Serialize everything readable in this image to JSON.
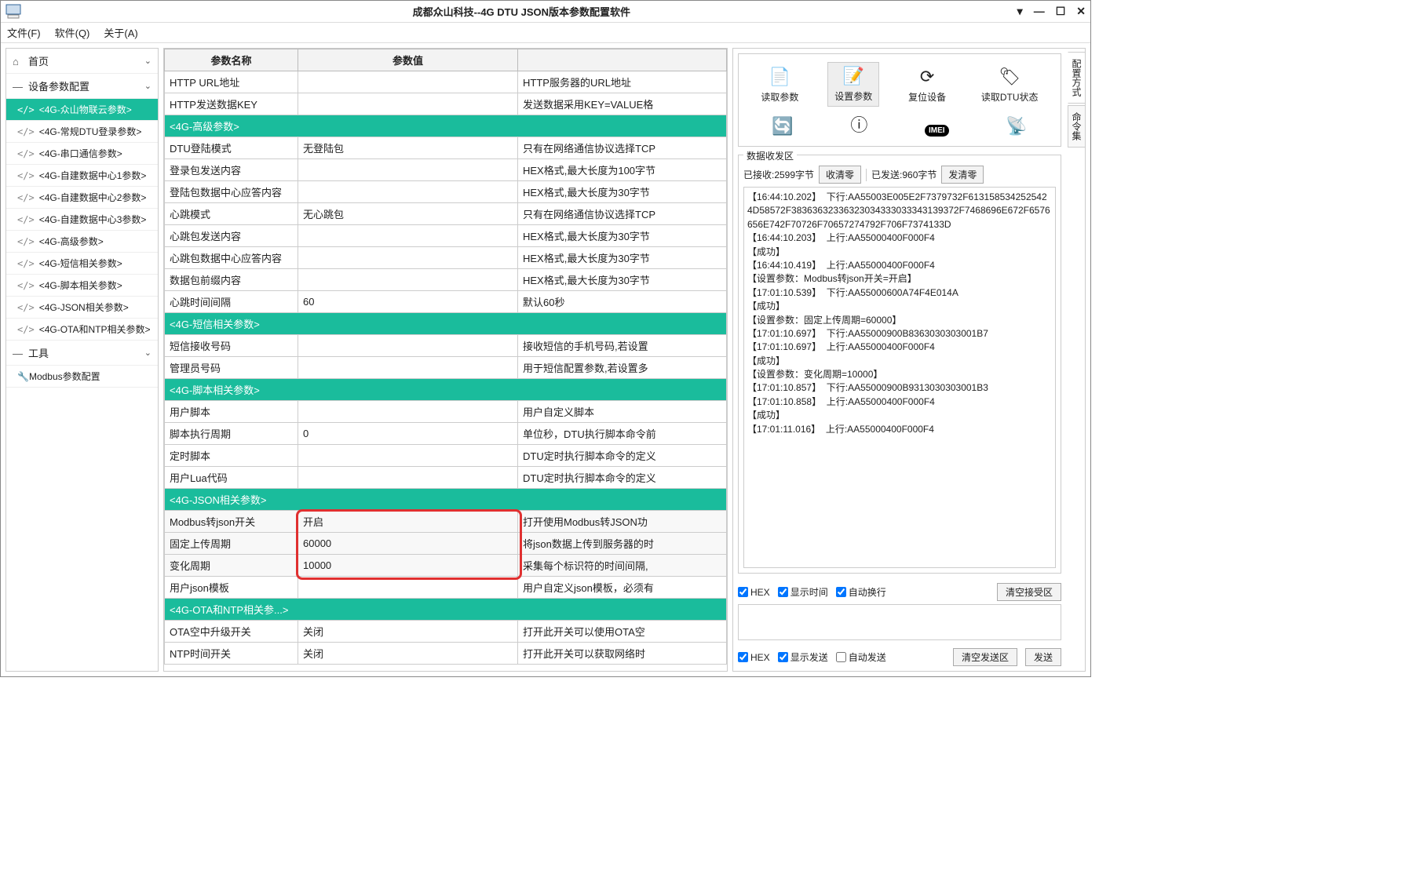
{
  "window": {
    "title": "成都众山科技--4G DTU JSON版本参数配置软件"
  },
  "menu": {
    "file": "文件(F)",
    "software": "软件(Q)",
    "about": "关于(A)"
  },
  "sidebar": {
    "home": "首页",
    "device_params": "设备参数配置",
    "tools": "工具",
    "modbus": "Modbus参数配置",
    "items": [
      "<4G-众山物联云参数>",
      "<4G-常规DTU登录参数>",
      "<4G-串口通信参数>",
      "<4G-自建数据中心1参数>",
      "<4G-自建数据中心2参数>",
      "<4G-自建数据中心3参数>",
      "<4G-高级参数>",
      "<4G-短信相关参数>",
      "<4G-脚本相关参数>",
      "<4G-JSON相关参数>",
      "<4G-OTA和NTP相关参数>"
    ]
  },
  "table": {
    "headers": {
      "name": "参数名称",
      "value": "参数值",
      "desc": ""
    },
    "rows": [
      {
        "name": "HTTP URL地址",
        "value": "",
        "desc": "HTTP服务器的URL地址"
      },
      {
        "name": "HTTP发送数据KEY",
        "value": "",
        "desc": "发送数据采用KEY=VALUE格"
      },
      {
        "section": "<4G-高级参数>"
      },
      {
        "name": "DTU登陆模式",
        "value": "无登陆包",
        "desc": "只有在网络通信协议选择TCP"
      },
      {
        "name": "登录包发送内容",
        "value": "",
        "desc": "HEX格式,最大长度为100字节"
      },
      {
        "name": "登陆包数据中心应答内容",
        "value": "",
        "desc": "HEX格式,最大长度为30字节"
      },
      {
        "name": "心跳模式",
        "value": "无心跳包",
        "desc": "只有在网络通信协议选择TCP"
      },
      {
        "name": "心跳包发送内容",
        "value": "",
        "desc": "HEX格式,最大长度为30字节"
      },
      {
        "name": "心跳包数据中心应答内容",
        "value": "",
        "desc": "HEX格式,最大长度为30字节"
      },
      {
        "name": "数据包前缀内容",
        "value": "",
        "desc": "HEX格式,最大长度为30字节"
      },
      {
        "name": "心跳时间间隔",
        "value": "60",
        "desc": "默认60秒"
      },
      {
        "section": "<4G-短信相关参数>"
      },
      {
        "name": "短信接收号码",
        "value": "",
        "desc": "接收短信的手机号码,若设置"
      },
      {
        "name": "管理员号码",
        "value": "",
        "desc": "用于短信配置参数,若设置多"
      },
      {
        "section": "<4G-脚本相关参数>"
      },
      {
        "name": "用户脚本",
        "value": "",
        "desc": "用户自定义脚本"
      },
      {
        "name": "脚本执行周期",
        "value": "0",
        "desc": "单位秒，DTU执行脚本命令前"
      },
      {
        "name": "定时脚本",
        "value": "",
        "desc": "DTU定时执行脚本命令的定义"
      },
      {
        "name": "用户Lua代码",
        "value": "",
        "desc": "DTU定时执行脚本命令的定义"
      },
      {
        "section": "<4G-JSON相关参数>"
      },
      {
        "name": "Modbus转json开关",
        "value": "开启",
        "desc": "打开使用Modbus转JSON功",
        "hl": true
      },
      {
        "name": "固定上传周期",
        "value": "60000",
        "desc": "将json数据上传到服务器的时",
        "hl": true
      },
      {
        "name": "变化周期",
        "value": "10000",
        "desc": "采集每个标识符的时间间隔,",
        "hl": true
      },
      {
        "name": "用户json模板",
        "value": "",
        "desc": "用户自定义json模板，必须有"
      },
      {
        "section": "<4G-OTA和NTP相关参...>"
      },
      {
        "name": "OTA空中升级开关",
        "value": "关闭",
        "desc": "打开此开关可以使用OTA空"
      },
      {
        "name": "NTP时间开关",
        "value": "关闭",
        "desc": "打开此开关可以获取网络时"
      }
    ]
  },
  "toolbar": {
    "read_params": "读取参数",
    "set_params": "设置参数",
    "reset_device": "复位设备",
    "read_status": "读取DTU状态"
  },
  "side_tabs": {
    "config_mode": "配置方式",
    "cmd_set": "命令集"
  },
  "dataarea": {
    "title": "数据收发区",
    "rx_label": "已接收:2599字节",
    "rx_clear": "收清零",
    "tx_label": "已发送:960字节",
    "tx_clear": "发清零",
    "log_text": "【16:44:10.202】  下行:AA55003E005E2F7379732F6131585342525424D58572F38363632336323034333033343139372F7468696E672F6576656E742F70726F70657274792F706F7374133D\n【16:44:10.203】  上行:AA55000400F000F4\n【成功】\n【16:44:10.419】  上行:AA55000400F000F4\n【设置参数：Modbus转json开关=开启】\n【17:01:10.539】  下行:AA55000600A74F4E014A\n【成功】\n【设置参数：固定上传周期=60000】\n【17:01:10.697】  下行:AA55000900B8363030303001B7\n【17:01:10.697】  上行:AA55000400F000F4\n【成功】\n【设置参数：变化周期=10000】\n【17:01:10.857】  下行:AA55000900B9313030303001B3\n【17:01:10.858】  上行:AA55000400F000F4\n【成功】\n【17:01:11.016】  上行:AA55000400F000F4"
  },
  "rx_options": {
    "hex": "HEX",
    "show_time": "显示时间",
    "auto_wrap": "自动换行",
    "clear_rx": "清空接受区"
  },
  "tx_options": {
    "hex": "HEX",
    "show_send": "显示发送",
    "auto_send": "自动发送",
    "clear_tx": "清空发送区",
    "send": "发送"
  }
}
